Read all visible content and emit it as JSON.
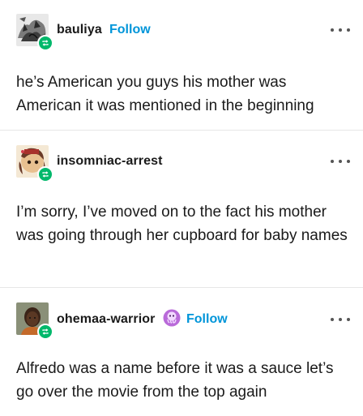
{
  "posts": [
    {
      "username": "bauliya",
      "follow_label": "Follow",
      "text": "he’s American you guys his mother was American it was mentioned in the beginning"
    },
    {
      "username": "insomniac-arrest",
      "text": "I’m sorry, I’ve moved on to the fact his mother was going through her cupboard for baby names"
    },
    {
      "username": "ohemaa-warrior",
      "follow_label": "Follow",
      "text": "Alfredo was a name before it was a sauce let’s go over the movie from the top again"
    }
  ],
  "icons": {
    "reblog": "reblog-icon",
    "more": "more-options-icon",
    "badge": "octopus-badge-icon"
  },
  "colors": {
    "follow": "#0095d9",
    "reblog_badge": "#00b86b",
    "badge": "#b96ad9"
  }
}
